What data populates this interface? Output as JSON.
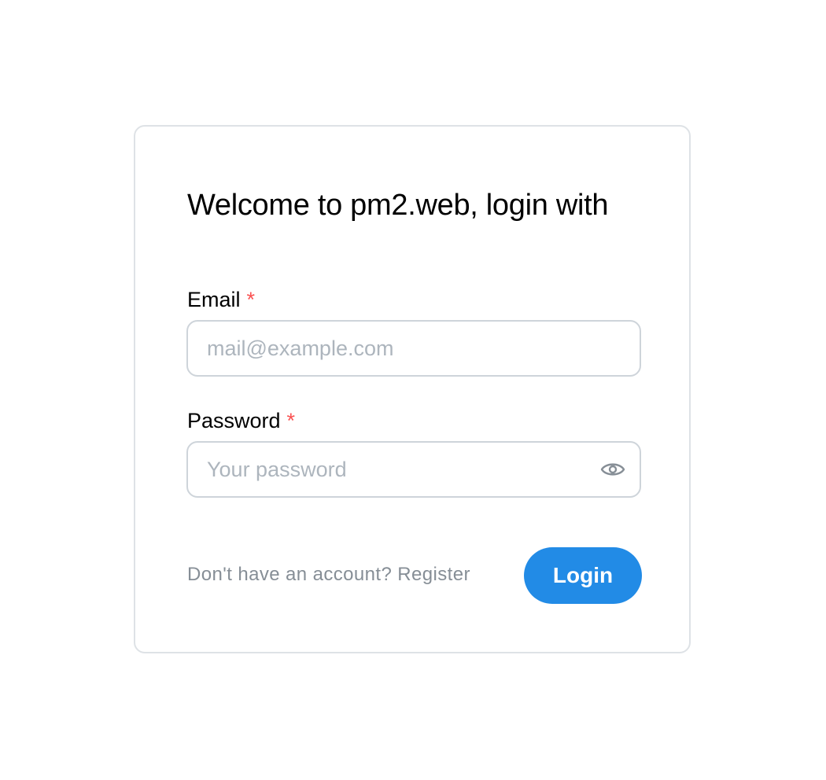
{
  "login_form": {
    "title": "Welcome to pm2.web, login with",
    "email": {
      "label": "Email",
      "required_mark": "*",
      "placeholder": "mail@example.com",
      "value": ""
    },
    "password": {
      "label": "Password",
      "required_mark": "*",
      "placeholder": "Your password",
      "value": "",
      "toggle_icon": "eye-icon"
    },
    "register_link": "Don't have an account? Register",
    "login_label": "Login"
  },
  "colors": {
    "accent": "#228be6",
    "required": "#fa5252",
    "border": "#ced4da",
    "card_border": "#dee2e6",
    "muted_text": "#868e96",
    "placeholder": "#adb5bd"
  }
}
